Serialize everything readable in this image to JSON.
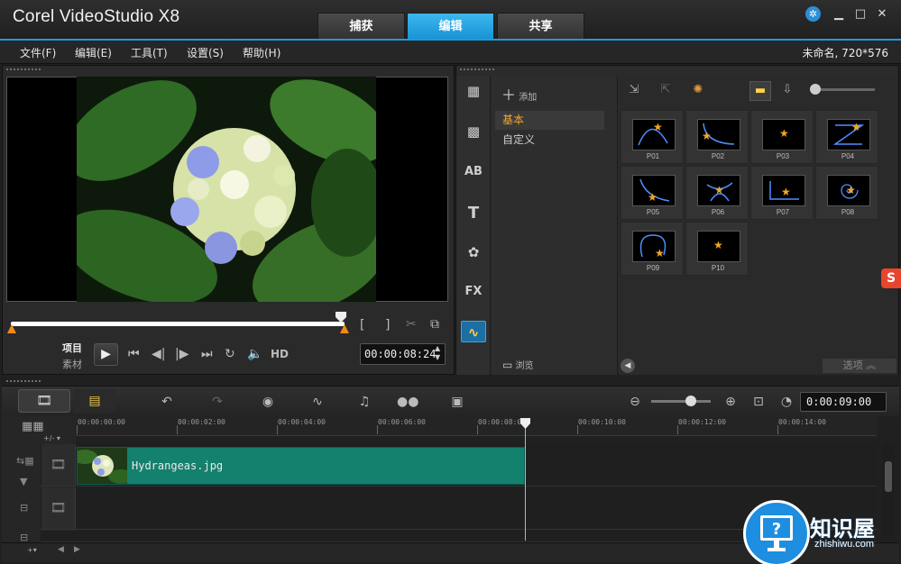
{
  "window": {
    "title": "Corel VideoStudio X8",
    "controls": [
      "minimize-icon",
      "maximize-icon",
      "close-icon"
    ]
  },
  "tabs": [
    {
      "label": "捕获",
      "active": false
    },
    {
      "label": "编辑",
      "active": true
    },
    {
      "label": "共享",
      "active": false
    }
  ],
  "menu": [
    {
      "label": "文件(F)"
    },
    {
      "label": "编辑(E)"
    },
    {
      "label": "工具(T)"
    },
    {
      "label": "设置(S)"
    },
    {
      "label": "帮助(H)"
    }
  ],
  "project_info": "未命名, 720*576",
  "preview": {
    "mode_project": "项目",
    "mode_clip": "素材",
    "hd_label": "HD",
    "timecode": "00:00:08:24",
    "bracket_in": "[",
    "bracket_out": "]"
  },
  "library": {
    "add_label": "添加",
    "browse_label": "浏览",
    "folders": [
      {
        "label": "基本",
        "active": true
      },
      {
        "label": "自定义",
        "active": false
      }
    ],
    "sidebar_icons": [
      "media-icon",
      "instant-project-icon",
      "transition-icon",
      "title-icon",
      "graphic-icon",
      "filter-icon",
      "path-icon"
    ],
    "items": [
      {
        "label": "P01"
      },
      {
        "label": "P02"
      },
      {
        "label": "P03"
      },
      {
        "label": "P04"
      },
      {
        "label": "P05"
      },
      {
        "label": "P06"
      },
      {
        "label": "P07"
      },
      {
        "label": "P08"
      },
      {
        "label": "P09"
      },
      {
        "label": "P10"
      }
    ],
    "options_label": "选项"
  },
  "timeline": {
    "timecode": "0:00:09:00",
    "ruler": [
      "00:00:00:00",
      "00:00:02:00",
      "00:00:04:00",
      "00:00:06:00",
      "00:00:08:00",
      "00:00:10:00",
      "00:00:12:00",
      "00:00:14:00"
    ],
    "clip_name": "Hydrangeas.jpg"
  },
  "watermark": {
    "text": "知识屋",
    "url": "zhishiwu.com"
  },
  "colors": {
    "accent": "#1b9be0",
    "clip": "#14806e",
    "active_folder": "#f0a830",
    "star": "#f5a623"
  }
}
